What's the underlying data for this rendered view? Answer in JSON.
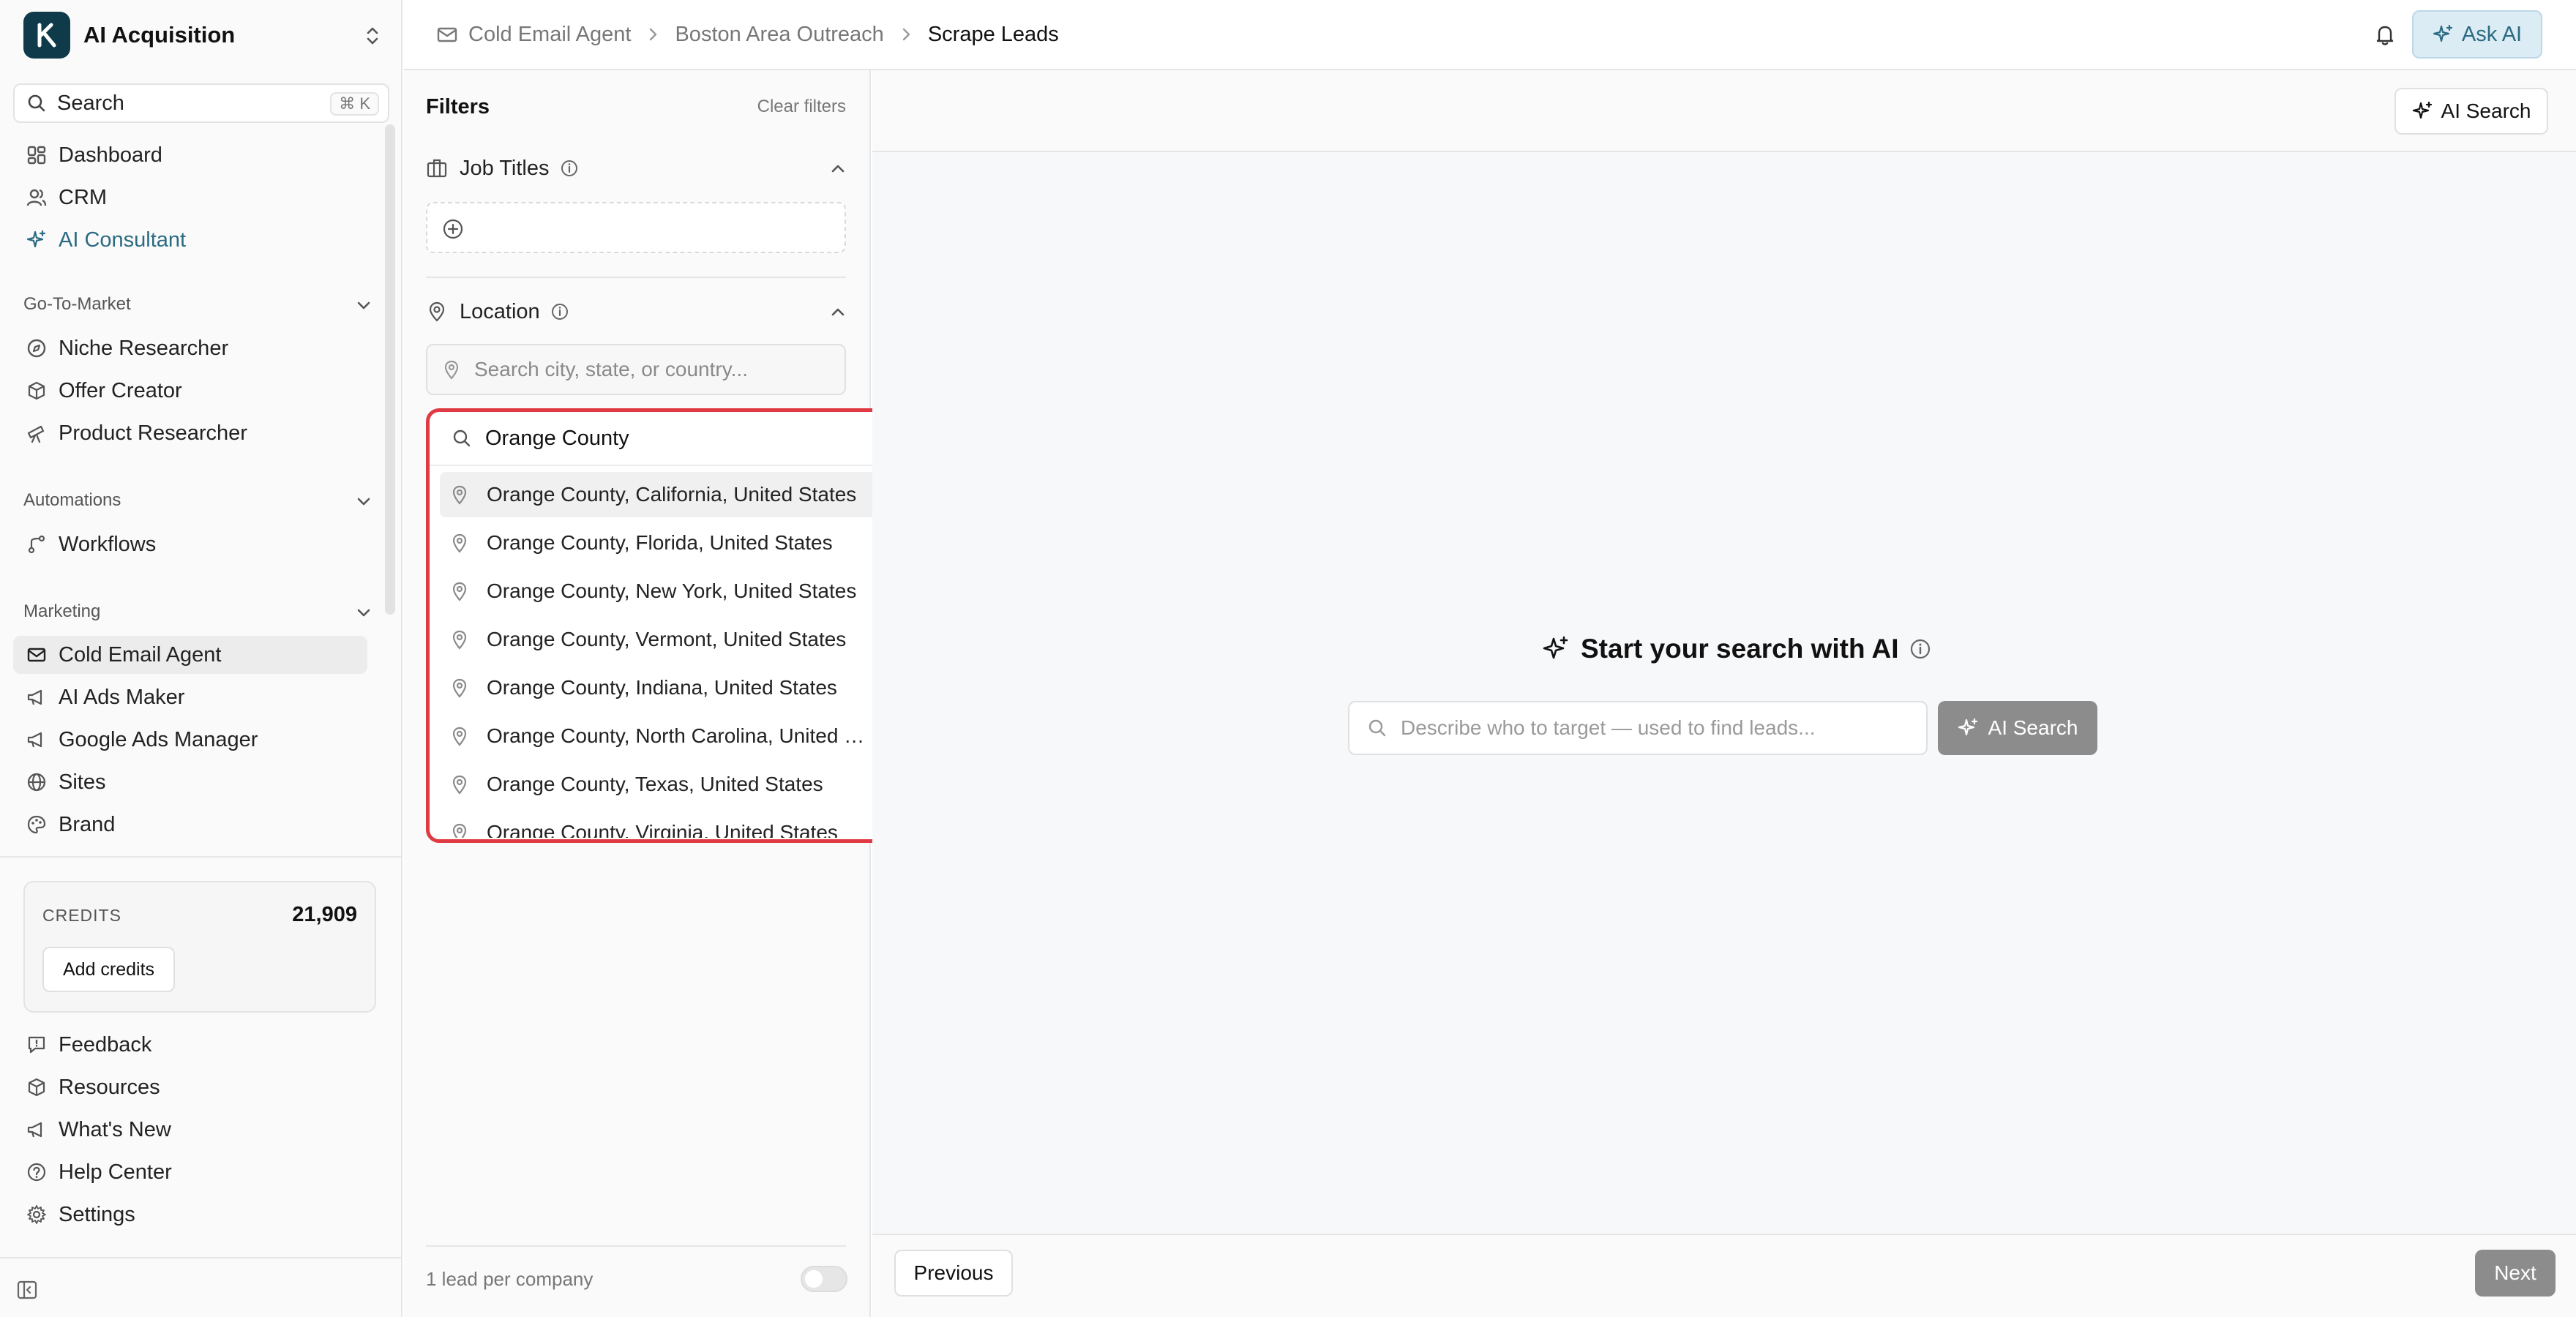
{
  "app": {
    "name": "AI Acquisition"
  },
  "sidebar": {
    "search_label": "Search",
    "search_shortcut": "⌘ K",
    "top_items": [
      {
        "label": "Dashboard",
        "icon": "dashboard-icon"
      },
      {
        "label": "CRM",
        "icon": "users-icon"
      },
      {
        "label": "AI Consultant",
        "icon": "sparkles-icon"
      }
    ],
    "sections": [
      {
        "title": "Go-To-Market",
        "items": [
          {
            "label": "Niche Researcher",
            "icon": "compass-icon"
          },
          {
            "label": "Offer Creator",
            "icon": "box-icon"
          },
          {
            "label": "Product Researcher",
            "icon": "telescope-icon"
          }
        ]
      },
      {
        "title": "Automations",
        "items": [
          {
            "label": "Workflows",
            "icon": "workflow-icon"
          }
        ]
      },
      {
        "title": "Marketing",
        "items": [
          {
            "label": "Cold Email Agent",
            "icon": "mail-icon"
          },
          {
            "label": "AI Ads Maker",
            "icon": "megaphone-icon"
          },
          {
            "label": "Google Ads Manager",
            "icon": "megaphone-icon"
          },
          {
            "label": "Sites",
            "icon": "globe-icon"
          },
          {
            "label": "Brand",
            "icon": "palette-icon"
          }
        ]
      }
    ],
    "credits": {
      "label": "CREDITS",
      "value": "21,909",
      "button": "Add credits"
    },
    "bottom_items": [
      {
        "label": "Feedback",
        "icon": "feedback-icon"
      },
      {
        "label": "Resources",
        "icon": "box-icon"
      },
      {
        "label": "What's New",
        "icon": "megaphone-icon"
      },
      {
        "label": "Help Center",
        "icon": "help-icon"
      },
      {
        "label": "Settings",
        "icon": "gear-icon"
      }
    ]
  },
  "breadcrumb": [
    "Cold Email Agent",
    "Boston Area Outreach",
    "Scrape Leads"
  ],
  "topbar": {
    "ask_ai": "Ask AI"
  },
  "filters": {
    "title": "Filters",
    "clear": "Clear filters",
    "job_titles": {
      "label": "Job Titles"
    },
    "location": {
      "label": "Location",
      "placeholder": "Search city, state, or country..."
    },
    "toggle_label": "1 lead per company",
    "toggle_on": false
  },
  "dropdown": {
    "query": "Orange County",
    "options": [
      "Orange County, California, United States",
      "Orange County, Florida, United States",
      "Orange County, New York, United States",
      "Orange County, Vermont, United States",
      "Orange County, Indiana, United States",
      "Orange County, North Carolina, United States",
      "Orange County, Texas, United States",
      "Orange County, Virginia, United States"
    ],
    "highlight_color": "#e03a44"
  },
  "main": {
    "ai_search_top": "AI Search",
    "hero_title": "Start your search with AI",
    "ai_input_placeholder": "Describe who to target — used to find leads...",
    "ai_search_button": "AI Search",
    "prev": "Previous",
    "next": "Next"
  },
  "colors": {
    "accent": "#2b6b82",
    "ask_ai_bg": "#dcecf4",
    "disabled_button": "#8c8c8c"
  }
}
